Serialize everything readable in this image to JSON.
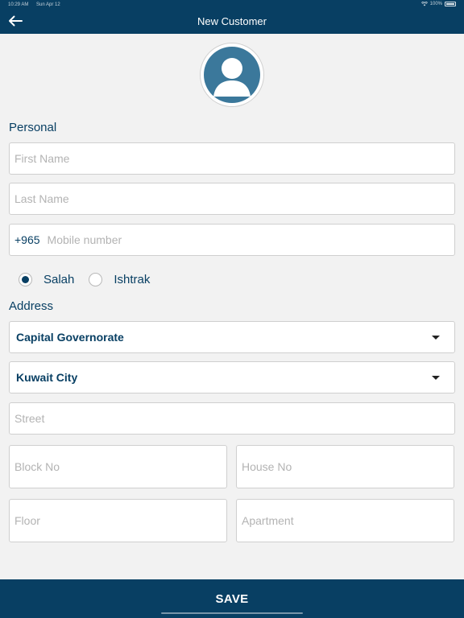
{
  "status_bar": {
    "time": "10:29 AM",
    "date": "Sun Apr 12",
    "battery": "100%"
  },
  "header": {
    "title": "New Customer",
    "back_icon": "arrow-left-icon"
  },
  "avatar": {
    "icon": "person-icon"
  },
  "personal": {
    "label": "Personal",
    "first_name_placeholder": "First Name",
    "last_name_placeholder": "Last Name",
    "mobile_prefix": "+965",
    "mobile_placeholder": "Mobile number"
  },
  "radio": {
    "options": [
      {
        "label": "Salah",
        "selected": true
      },
      {
        "label": "Ishtrak",
        "selected": false
      }
    ]
  },
  "address": {
    "label": "Address",
    "governorate": "Capital Governorate",
    "city": "Kuwait City",
    "street_placeholder": "Street",
    "block_placeholder": "Block No",
    "house_placeholder": "House No",
    "floor_placeholder": "Floor",
    "apartment_placeholder": "Apartment"
  },
  "footer": {
    "save_label": "SAVE"
  },
  "colors": {
    "primary": "#083f63",
    "avatar": "#3b789b",
    "background": "#f2f2f2"
  }
}
